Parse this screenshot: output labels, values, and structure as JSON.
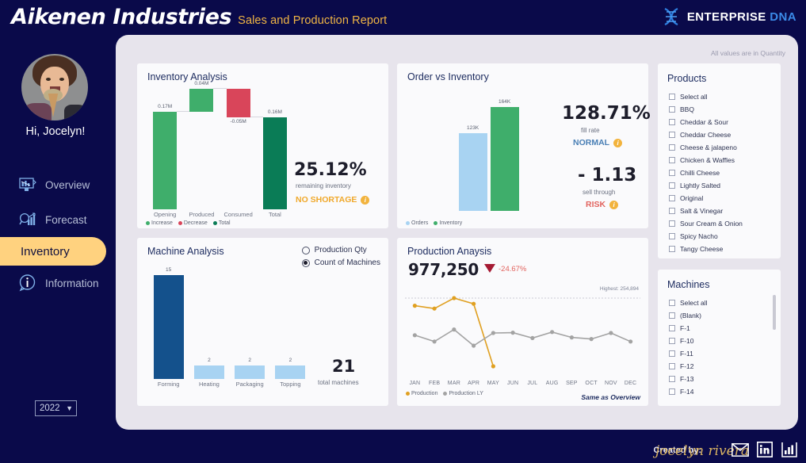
{
  "header": {
    "brand_name": "Aikenen Industries",
    "brand_subtitle": "Sales and Production Report",
    "logo_word1": "ENTERPRISE",
    "logo_word2": "DNA"
  },
  "sidebar": {
    "greeting": "Hi, Jocelyn!",
    "items": [
      {
        "label": "Overview",
        "icon": "monitor-chart-icon",
        "active": false
      },
      {
        "label": "Forecast",
        "icon": "magnifier-chart-icon",
        "active": false
      },
      {
        "label": "Inventory",
        "icon": "box-icon",
        "active": true
      },
      {
        "label": "Information",
        "icon": "info-circle-icon",
        "active": false
      }
    ],
    "year_selected": "2022",
    "year_options": [
      "2022"
    ]
  },
  "canvas": {
    "note": "All values are in Quantity"
  },
  "chart_data": [
    {
      "type": "bar",
      "title": "Inventory Analysis",
      "subtype": "waterfall",
      "categories": [
        "Opening",
        "Produced",
        "Consumed",
        "Total"
      ],
      "value_labels": [
        "0.17M",
        "0.04M",
        "-0.05M",
        "0.16M"
      ],
      "values": [
        0.17,
        0.04,
        -0.05,
        0.16
      ],
      "ylabel": "",
      "xlabel": "",
      "legend": [
        {
          "label": "Increase",
          "color": "#3fae6b"
        },
        {
          "label": "Decrease",
          "color": "#d9455a"
        },
        {
          "label": "Total",
          "color": "#0a7c56"
        }
      ],
      "kpi": {
        "value": "25.12%",
        "caption": "remaining inventory",
        "status": "NO SHORTAGE",
        "status_color": "#f0a92c"
      }
    },
    {
      "type": "bar",
      "title": "Order vs Inventory",
      "categories": [
        "Orders",
        "Inventory"
      ],
      "value_labels": [
        "123K",
        "164K"
      ],
      "values": [
        123000,
        164000
      ],
      "legend": [
        {
          "label": "Orders",
          "color": "#a8d3f2"
        },
        {
          "label": "Inventory",
          "color": "#3fae6b"
        }
      ],
      "kpis": [
        {
          "value": "128.71%",
          "caption": "fill rate",
          "status": "NORMAL",
          "status_color": "#4a7fb5"
        },
        {
          "value": "- 1.13",
          "caption": "sell through",
          "status": "RISK",
          "status_color": "#e2645f"
        }
      ]
    },
    {
      "type": "bar",
      "title": "Machine Analysis",
      "categories": [
        "Forming",
        "Heating",
        "Packaging",
        "Topping"
      ],
      "values": [
        15,
        2,
        2,
        2
      ],
      "value_labels": [
        "15",
        "2",
        "2",
        "2"
      ],
      "measure_options": [
        "Production Qty",
        "Count of Machines"
      ],
      "measure_selected": "Count of Machines",
      "total": {
        "value": "21",
        "caption": "total machines"
      }
    },
    {
      "type": "line",
      "title": "Production Anaysis",
      "kpi_value": "977,250",
      "kpi_delta": "-24.67%",
      "kpi_trend": "down",
      "annotation": "Highest: 254,894",
      "footnote": "Same as Overview",
      "categories": [
        "JAN",
        "FEB",
        "MAR",
        "APR",
        "MAY",
        "JUN",
        "JUL",
        "AUG",
        "SEP",
        "OCT",
        "NOV",
        "DEC"
      ],
      "series": [
        {
          "name": "Production",
          "color": "#e0a021",
          "values": [
            231000,
            222000,
            255000,
            237000,
            40000,
            null,
            null,
            null,
            null,
            null,
            null,
            null
          ]
        },
        {
          "name": "Production LY",
          "color": "#a3a3a3",
          "values": [
            138000,
            118000,
            156000,
            105000,
            145000,
            146000,
            129000,
            148000,
            131000,
            126000,
            145000,
            118000
          ]
        }
      ]
    }
  ],
  "slicers": {
    "products": {
      "title": "Products",
      "items": [
        "Select all",
        "BBQ",
        "Cheddar & Sour",
        "Cheddar Cheese",
        "Cheese & jalapeno",
        "Chicken & Waffles",
        "Chilli Cheese",
        "Lightly Salted",
        "Original",
        "Salt & Vinegar",
        "Sour Cream & Onion",
        "Spicy Nacho",
        "Tangy Cheese"
      ]
    },
    "machines": {
      "title": "Machines",
      "items": [
        "Select all",
        "(Blank)",
        "F-1",
        "F-10",
        "F-11",
        "F-12",
        "F-13",
        "F-14"
      ]
    }
  },
  "footer": {
    "created_by_label": "Created by:",
    "signature": "jocelyn rivera",
    "socials": [
      "email-icon",
      "linkedin-icon",
      "chart-icon"
    ]
  }
}
